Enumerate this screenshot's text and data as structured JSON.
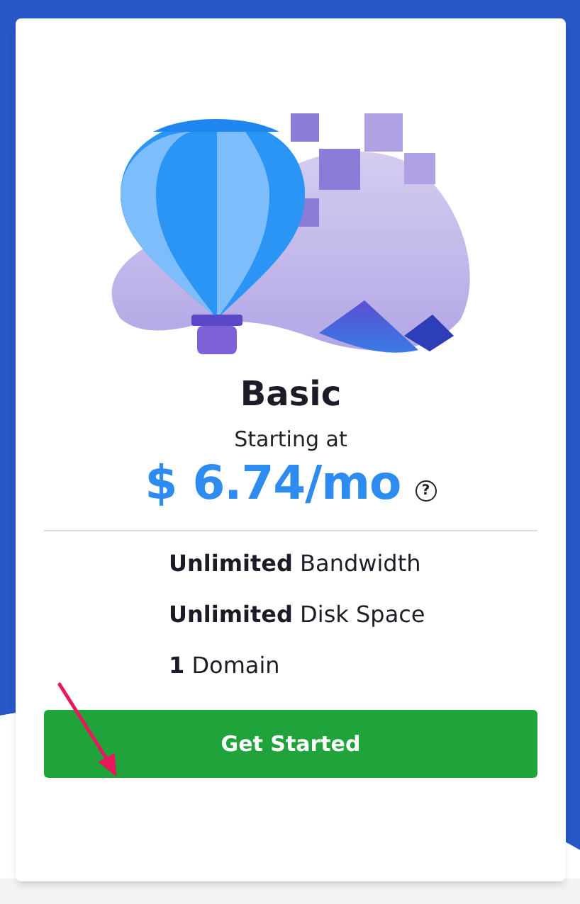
{
  "plan": {
    "title": "Basic",
    "price_caption": "Starting at",
    "price": "$ 6.74/mo",
    "help_icon_text": "?",
    "features": [
      "**Unlimited** Bandwidth",
      "**Unlimited** Disk Space",
      "**1** Domain"
    ],
    "button": "Get Started"
  }
}
